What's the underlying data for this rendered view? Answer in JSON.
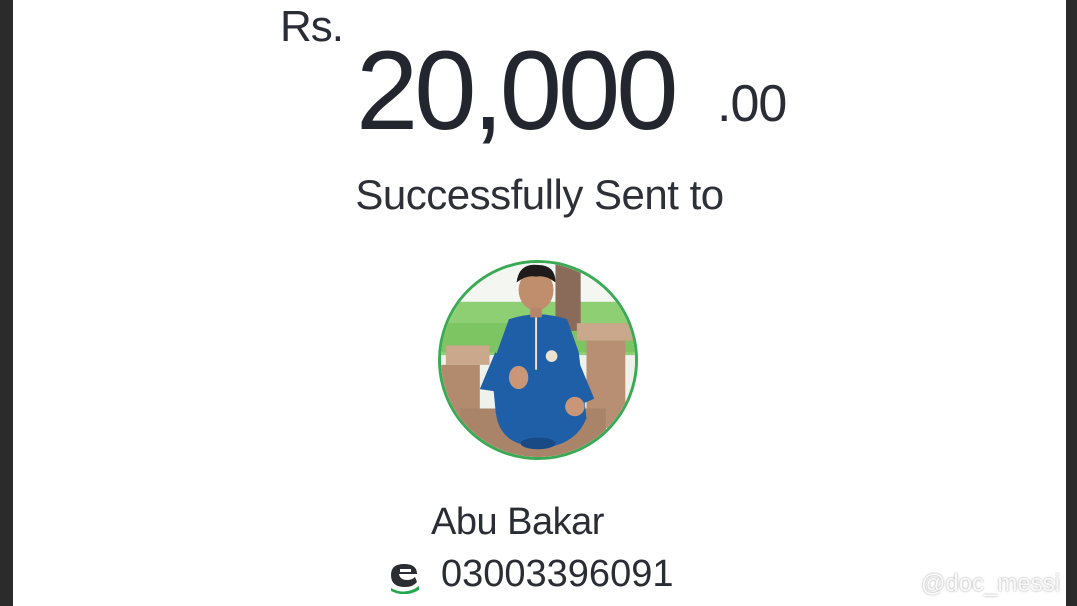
{
  "transaction": {
    "currency": "Rs.",
    "amount_main": "20,000",
    "amount_decimal": ".00",
    "status": "Successfully Sent to"
  },
  "recipient": {
    "name": "Abu Bakar",
    "number": "03003396091",
    "wallet_icon": "easypaisa-logo-icon"
  },
  "watermark": {
    "text": "@doc_messi"
  },
  "colors": {
    "avatar_ring": "#3aaa55",
    "text": "#2a2d36",
    "wallet_brand": "#23a84e"
  }
}
